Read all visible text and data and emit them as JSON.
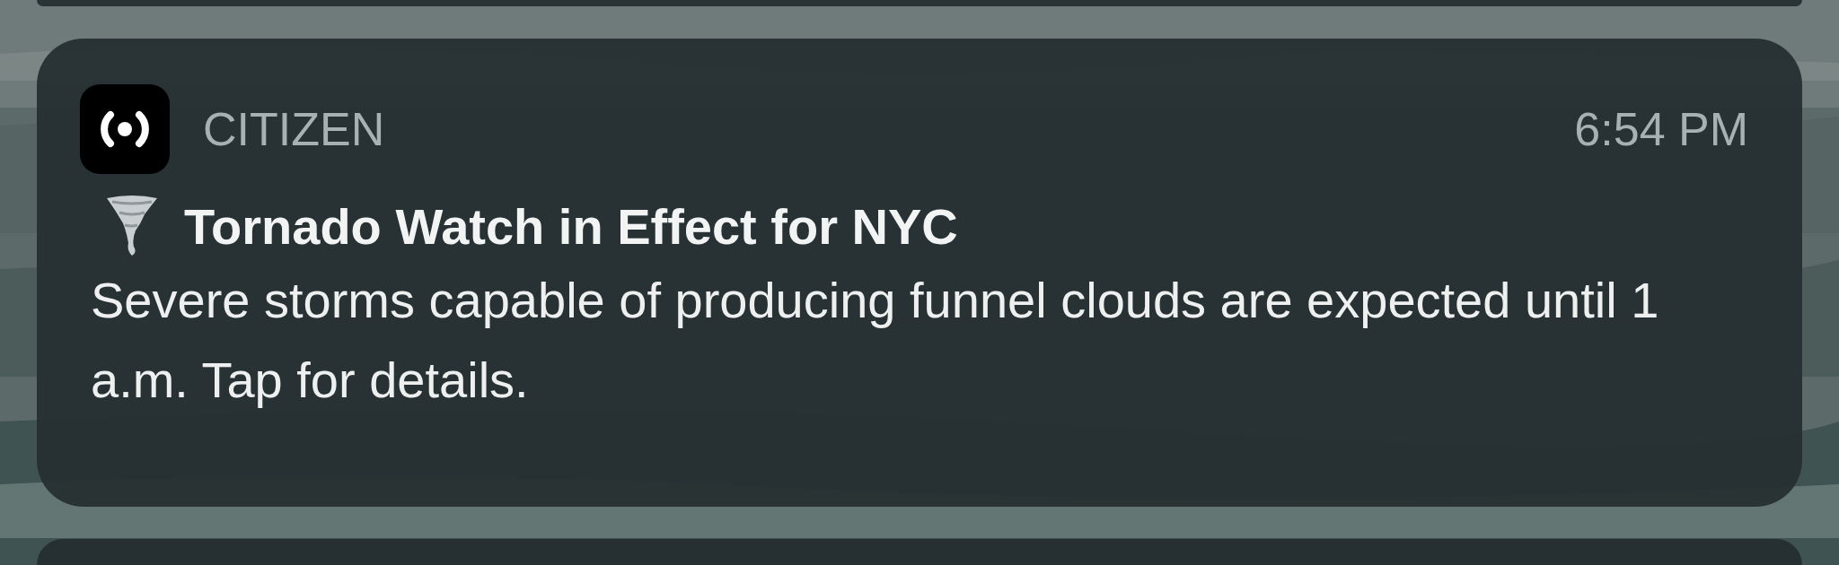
{
  "notification": {
    "app_name": "CITIZEN",
    "time": "6:54 PM",
    "title": "Tornado Watch in Effect for NYC",
    "body": "Severe storms capable of producing funnel clouds are expected until 1 a.m. Tap for details."
  }
}
